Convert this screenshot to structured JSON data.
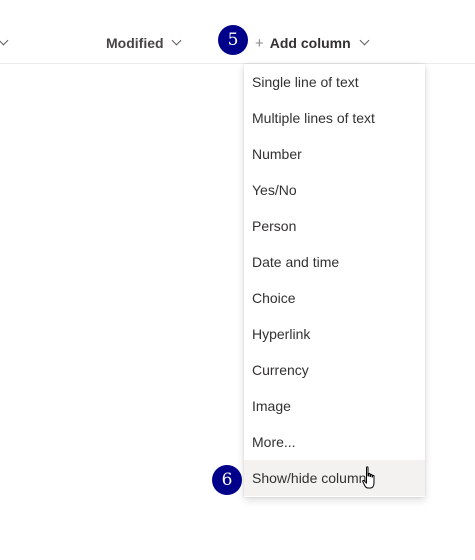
{
  "header": {
    "modified_label": "Modified",
    "add_column_label": "Add column"
  },
  "annotations": {
    "step_5": "5",
    "step_6": "6"
  },
  "menu": {
    "items": [
      {
        "label": "Single line of text"
      },
      {
        "label": "Multiple lines of text"
      },
      {
        "label": "Number"
      },
      {
        "label": "Yes/No"
      },
      {
        "label": "Person"
      },
      {
        "label": "Date and time"
      },
      {
        "label": "Choice"
      },
      {
        "label": "Hyperlink"
      },
      {
        "label": "Currency"
      },
      {
        "label": "Image"
      },
      {
        "label": "More..."
      },
      {
        "label": "Show/hide columns",
        "hovered": true
      }
    ]
  },
  "colors": {
    "badge": "#00008b",
    "hover_bg": "#f3f2f1"
  },
  "icons": [
    "chevron-down-icon",
    "plus-icon",
    "hand-cursor-icon"
  ]
}
